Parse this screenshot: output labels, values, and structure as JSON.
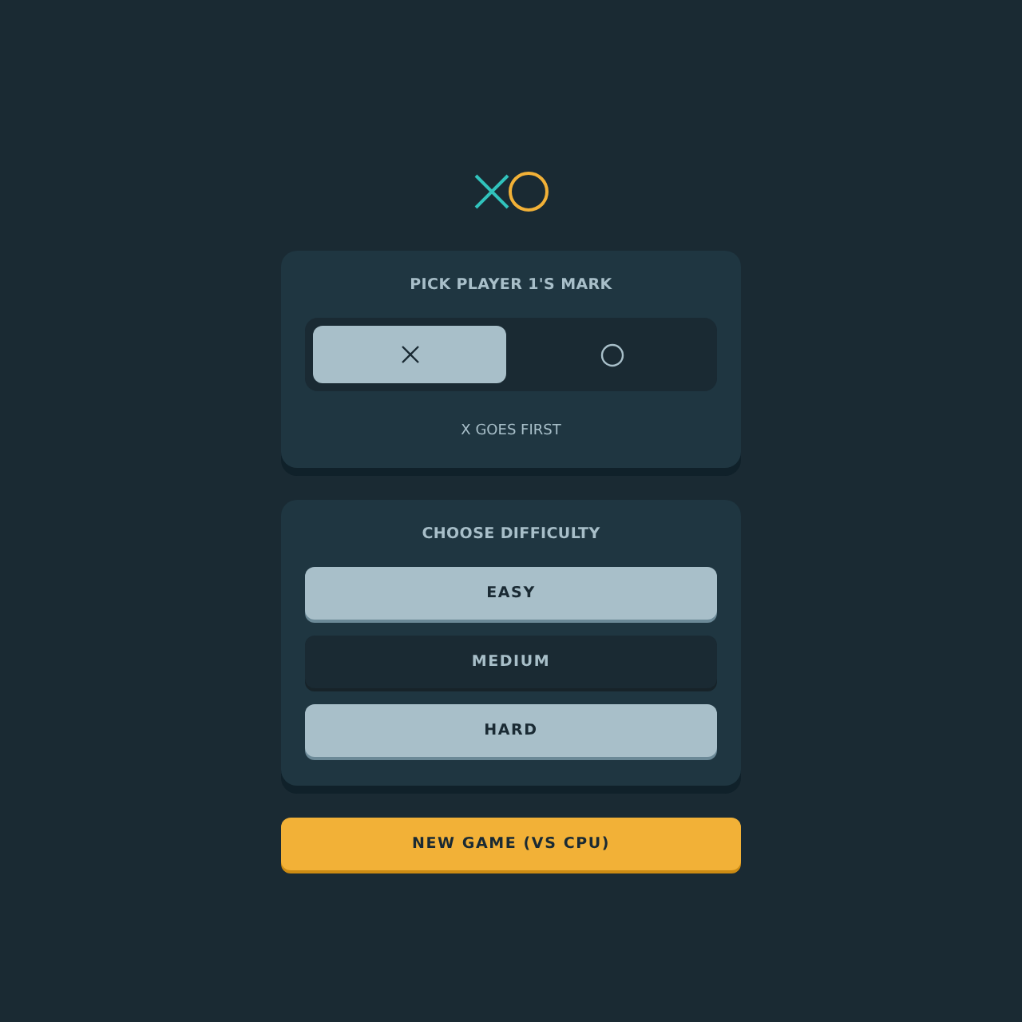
{
  "mark_picker": {
    "title": "PICK PLAYER 1'S MARK",
    "marks": [
      {
        "kind": "x",
        "selected": true
      },
      {
        "kind": "o",
        "selected": false
      }
    ],
    "note": "X GOES FIRST"
  },
  "difficulty": {
    "title": "CHOOSE DIFFICULTY",
    "options": [
      {
        "label": "EASY",
        "selected": true
      },
      {
        "label": "MEDIUM",
        "selected": false
      },
      {
        "label": "HARD",
        "selected": true
      }
    ]
  },
  "new_game_button": "NEW GAME (VS CPU)"
}
